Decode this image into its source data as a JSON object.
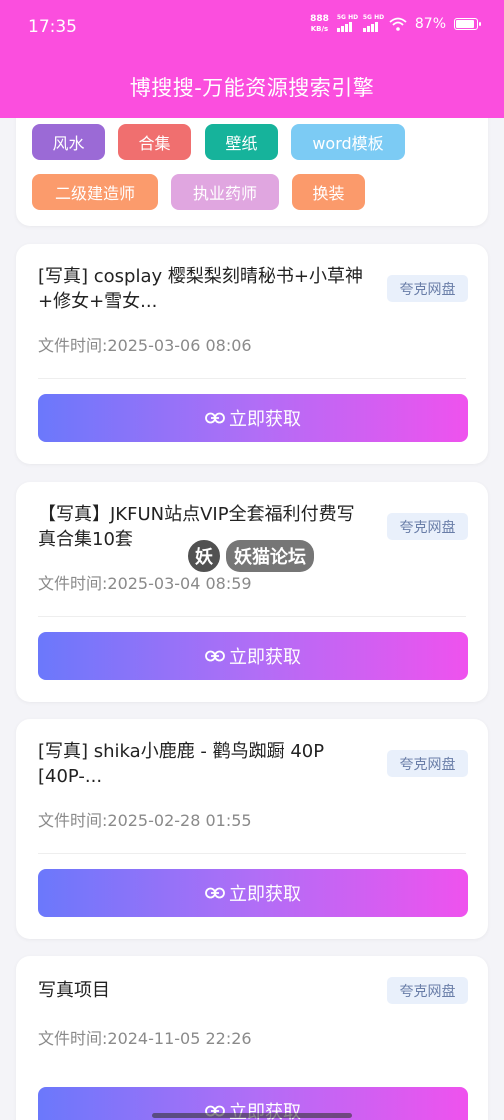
{
  "status_bar": {
    "time": "17:35",
    "net_speed_value": "888",
    "net_speed_unit": "KB/s",
    "signal_label_1": "5G HD",
    "signal_label_2": "5G HD",
    "battery_percent": "87%"
  },
  "header": {
    "title": "博搜搜-万能资源搜索引擎"
  },
  "tags": [
    {
      "label": "风水",
      "color": "#9b6ad6"
    },
    {
      "label": "合集",
      "color": "#f06f6f"
    },
    {
      "label": "壁纸",
      "color": "#16b39b"
    },
    {
      "label": "word模板",
      "color": "#7ccbf4"
    },
    {
      "label": "二级建造师",
      "color": "#fb9b6c"
    },
    {
      "label": "执业药师",
      "color": "#e0a6e0"
    },
    {
      "label": "换装",
      "color": "#fb9a6b"
    }
  ],
  "results": [
    {
      "title": "[写真] cosplay 樱梨梨刻晴秘书+小草神+修女+雪女...",
      "badge": "夸克网盘",
      "time": "文件时间:2025-03-06 08:06",
      "button": "立即获取"
    },
    {
      "title": "【写真】JKFUN站点VIP全套福利付费写真合集10套",
      "badge": "夸克网盘",
      "time": "文件时间:2025-03-04 08:59",
      "button": "立即获取"
    },
    {
      "title": "[写真] shika小鹿鹿 - 鹳鸟踟蹰 40P [40P-...",
      "badge": "夸克网盘",
      "time": "文件时间:2025-02-28 01:55",
      "button": "立即获取"
    },
    {
      "title": "写真项目",
      "badge": "夸克网盘",
      "time": "文件时间:2024-11-05 22:26",
      "button": "立即获取"
    }
  ],
  "watermark": {
    "text": "妖猫论坛"
  },
  "colors": {
    "header": "#fb4ede",
    "badge_bg": "#e9f0fb",
    "badge_text": "#6a7ea8"
  }
}
